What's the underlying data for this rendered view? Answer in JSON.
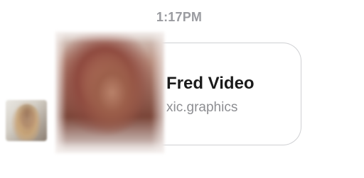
{
  "message": {
    "timestamp": "1:17PM",
    "link_preview": {
      "title": "Fred Video",
      "domain": "xic.graphics"
    }
  },
  "colors": {
    "timestamp": "#9a9ba0",
    "bubble_border": "#cfd0d3",
    "title": "#1b1b1b",
    "domain": "#8d8e92"
  }
}
